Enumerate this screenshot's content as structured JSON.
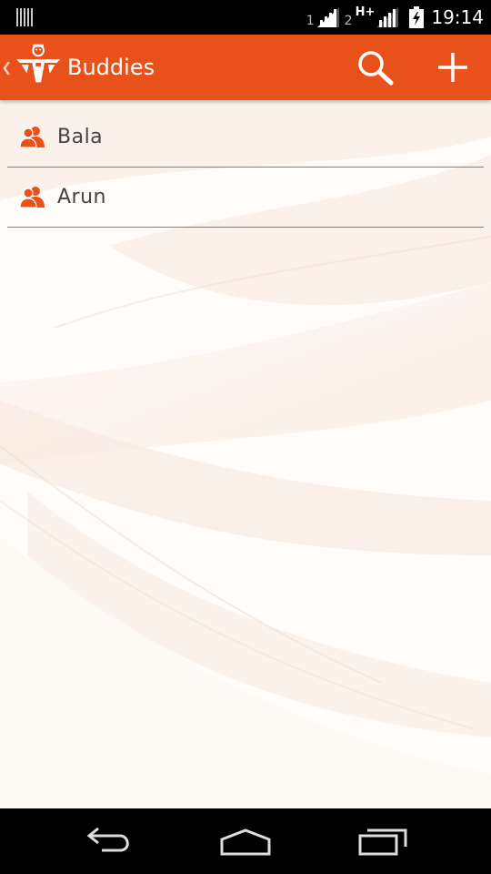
{
  "status_bar": {
    "sim1": "1",
    "sim2": "2",
    "network_type": "H+",
    "time": "19:14",
    "icons": [
      "sd-card-icon",
      "signal-icon",
      "signal-icon",
      "battery-charging-icon"
    ]
  },
  "action_bar": {
    "title": "Buddies",
    "up_icon": "chevron-left-icon",
    "logo_icon": "app-logo-icon",
    "search_icon": "search-icon",
    "add_icon": "plus-icon",
    "color": "#e8511a"
  },
  "buddies": [
    {
      "name": "Bala",
      "icon": "buddy-icon"
    },
    {
      "name": "Arun",
      "icon": "buddy-icon"
    }
  ],
  "nav_bar": {
    "icons": [
      "back-icon",
      "home-icon",
      "recents-icon"
    ]
  },
  "colors": {
    "accent": "#e8511a",
    "divider": "#c86a2e",
    "text": "#444444"
  }
}
